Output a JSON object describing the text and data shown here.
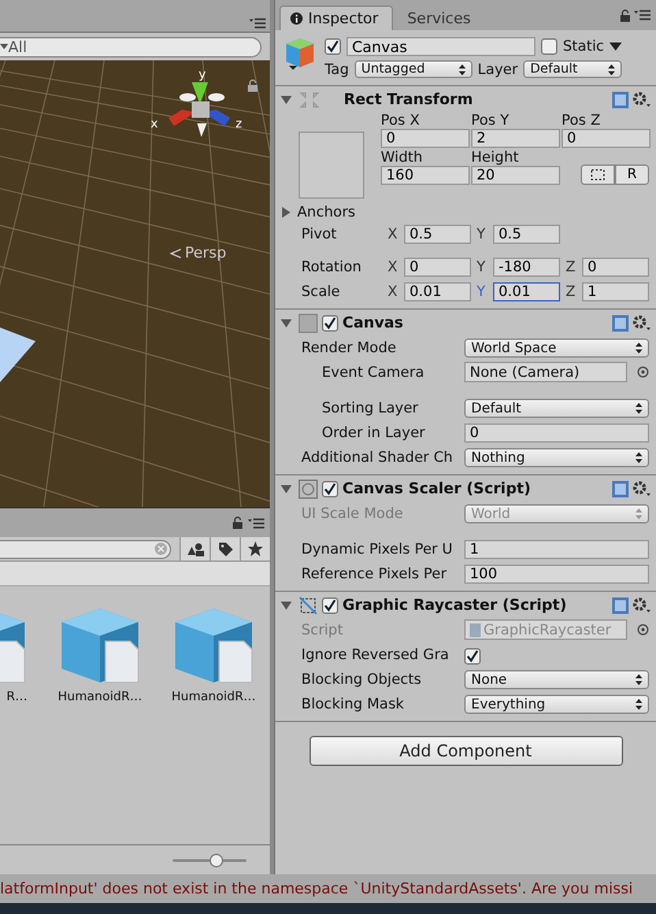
{
  "scene": {
    "search_placeholder": "All",
    "view_label": "Persp",
    "axes": {
      "y": "y",
      "x": "x",
      "z": "z"
    }
  },
  "project": {
    "assets": [
      {
        "name": "R…"
      },
      {
        "name": "HumanoidR…"
      },
      {
        "name": "HumanoidR…"
      }
    ],
    "zoom": {
      "level": 0.6
    }
  },
  "status_bar": {
    "message": "latformInput' does not exist in the namespace `UnityStandardAssets'. Are you missi"
  },
  "inspector": {
    "tabs": [
      {
        "label": "Inspector",
        "selected": true
      },
      {
        "label": "Services",
        "selected": false
      }
    ],
    "object": {
      "active": true,
      "name": "Canvas",
      "static": false,
      "static_label": "Static",
      "tag_label": "Tag",
      "tag": "Untagged",
      "layer_label": "Layer",
      "layer": "Default"
    },
    "rect_transform": {
      "title": "Rect Transform",
      "expanded": true,
      "position": [
        {
          "label": "Pos X",
          "value": "0"
        },
        {
          "label": "Pos Y",
          "value": "2"
        },
        {
          "label": "Pos Z",
          "value": "0"
        }
      ],
      "size": [
        {
          "label": "Width",
          "value": "160"
        },
        {
          "label": "Height",
          "value": "20"
        }
      ],
      "raw_button": "R",
      "anchors": {
        "label": "Anchors",
        "expanded": false
      },
      "vectors": [
        {
          "label": "Pivot",
          "spaced": false,
          "axes": [
            {
              "axis": "X",
              "value": "0.5",
              "focused": false
            },
            {
              "axis": "Y",
              "value": "0.5",
              "focused": false
            }
          ]
        },
        {
          "label": "Rotation",
          "spaced": true,
          "axes": [
            {
              "axis": "X",
              "value": "0",
              "focused": false
            },
            {
              "axis": "Y",
              "value": "-180",
              "focused": false
            },
            {
              "axis": "Z",
              "value": "0",
              "focused": false
            }
          ]
        },
        {
          "label": "Scale",
          "spaced": false,
          "axes": [
            {
              "axis": "X",
              "value": "0.01",
              "focused": false
            },
            {
              "axis": "Y",
              "value": "0.01",
              "focused": true
            },
            {
              "axis": "Z",
              "value": "1",
              "focused": false
            }
          ]
        }
      ]
    },
    "components": [
      {
        "title": "Canvas",
        "kind": "canvas",
        "enabled": true,
        "expanded": true,
        "rows": [
          {
            "kind": "dropdown",
            "label": "Render Mode",
            "value": "World Space",
            "indented": false,
            "spaced": false,
            "disabled": false
          },
          {
            "kind": "object",
            "label": "Event Camera",
            "value": "None (Camera)",
            "indented": true,
            "spaced": false,
            "disabled": false
          },
          {
            "kind": "dropdown",
            "label": "Sorting Layer",
            "value": "Default",
            "indented": true,
            "spaced": true,
            "disabled": false
          },
          {
            "kind": "text",
            "label": "Order in Layer",
            "value": "0",
            "indented": true,
            "spaced": false,
            "disabled": false
          },
          {
            "kind": "dropdown",
            "label": "Additional Shader Ch",
            "value": "Nothing",
            "indented": false,
            "spaced": false,
            "disabled": false
          }
        ]
      },
      {
        "title": "Canvas Scaler (Script)",
        "kind": "scaler",
        "enabled": true,
        "expanded": true,
        "rows": [
          {
            "kind": "dropdown",
            "label": "UI Scale Mode",
            "value": "World",
            "indented": false,
            "spaced": false,
            "disabled": true
          },
          {
            "kind": "text",
            "label": "Dynamic Pixels Per U",
            "value": "1",
            "indented": false,
            "spaced": true,
            "disabled": false
          },
          {
            "kind": "text",
            "label": "Reference Pixels Per",
            "value": "100",
            "indented": false,
            "spaced": false,
            "disabled": false
          }
        ]
      },
      {
        "title": "Graphic Raycaster (Script)",
        "kind": "raycaster",
        "enabled": true,
        "expanded": true,
        "rows": [
          {
            "kind": "object",
            "label": "Script",
            "value": "GraphicRaycaster",
            "indented": false,
            "spaced": false,
            "disabled": true
          },
          {
            "kind": "checkbox",
            "label": "Ignore Reversed Gra",
            "checked": true,
            "indented": false,
            "spaced": false,
            "disabled": false
          },
          {
            "kind": "dropdown",
            "label": "Blocking Objects",
            "value": "None",
            "indented": false,
            "spaced": false,
            "disabled": false
          },
          {
            "kind": "dropdown",
            "label": "Blocking Mask",
            "value": "Everything",
            "indented": false,
            "spaced": false,
            "disabled": false
          }
        ]
      }
    ],
    "add_button": "Add Component"
  }
}
